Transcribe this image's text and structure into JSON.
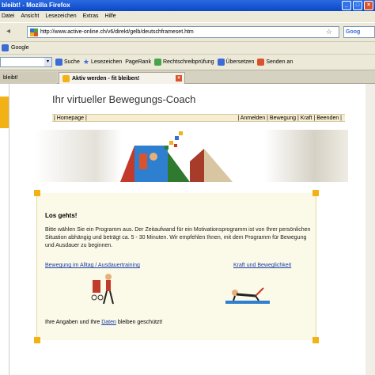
{
  "window": {
    "title": "bleibt! - Mozilla Firefox"
  },
  "menu": [
    "Datei",
    "Ansicht",
    "Lesezeichen",
    "Extras",
    "Hilfe"
  ],
  "address": {
    "url": "http://www.active-online.ch/v6/direkt/gelb/deutschframeset.htm",
    "search_label": "Goog"
  },
  "bookmarks": {
    "google_label": "Google"
  },
  "toolbar": {
    "search_label": "Suche",
    "bookmarks_label": "Lesezeichen",
    "pagerank_label": "PageRank",
    "spellcheck_label": "Rechtschreibprüfung",
    "translate_label": "Übersetzen",
    "send_label": "Senden an"
  },
  "tabs": [
    {
      "label": "bleibt!"
    },
    {
      "label": "Aktiv werden - fit bleiben!"
    }
  ],
  "page": {
    "title": "Ihr virtueller Bewegungs-Coach",
    "nav_left": "| Homepage |",
    "nav_right": "| Anmelden | Bewegung | Kraft | Beenden |",
    "heading": "Los gehts!",
    "intro": "Bitte wählen Sie ein Programm aus. Der Zeitaufwand für ein Motivationsprogramm ist von Ihrer persönlichen Situation abhängig und beträgt ca. 5 - 30 Minuten. Wir empfehlen Ihnen, mit dem Programm für Bewegung und Ausdauer zu beginnen.",
    "link_movement": "Bewegung im Alltag / Ausdauertraining",
    "link_strength": "Kraft und Beweglichkeit",
    "footnote_pre": "Ihre Angaben und Ihre",
    "footnote_link": "Daten",
    "footnote_post": "bleiben geschützt!"
  },
  "colors": {
    "accent_yellow": "#f2b215",
    "link_blue": "#1a3ea8",
    "panel_bg": "#fbf9e8"
  }
}
